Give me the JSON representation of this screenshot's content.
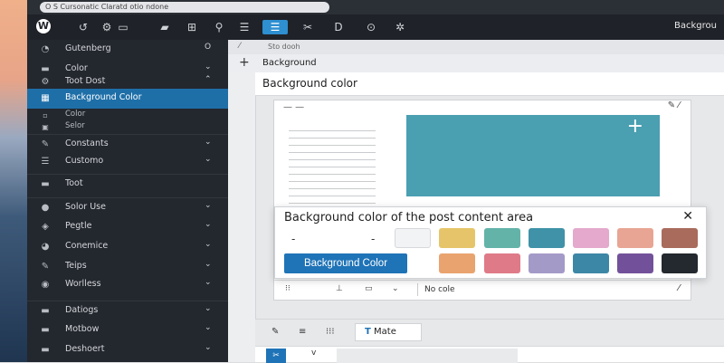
{
  "browser": {
    "url": "O  S Cursonatic Claratd otio ndone"
  },
  "adminbar": {
    "right_label": "Backgrou"
  },
  "sidebar": {
    "items": [
      {
        "label": "Gutenberg",
        "chev": "O"
      },
      {
        "label": "Color",
        "chev": "⌄"
      },
      {
        "label": "Toot Dost",
        "chev": "⌃"
      },
      {
        "label": "Background Color",
        "chev": ""
      },
      {
        "label": "Color",
        "chev": ""
      },
      {
        "label": "Selor",
        "chev": ""
      },
      {
        "label": "Constants",
        "chev": "⌄"
      },
      {
        "label": "Customo",
        "chev": "⌄"
      },
      {
        "label": "Toot",
        "chev": ""
      },
      {
        "label": "Solor Use",
        "chev": "⌄"
      },
      {
        "label": "Pegtle",
        "chev": "⌄"
      },
      {
        "label": "Conemice",
        "chev": "⌄"
      },
      {
        "label": "Teips",
        "chev": "⌄"
      },
      {
        "label": "Worlless",
        "chev": "⌄"
      },
      {
        "label": "Datiogs",
        "chev": "⌄"
      },
      {
        "label": "Motbow",
        "chev": "⌄"
      },
      {
        "label": "Deshoert",
        "chev": "⌄"
      }
    ]
  },
  "main": {
    "breadcrumb": "Sto dooh",
    "panel_title": "Background",
    "title": "Background color",
    "preview": {
      "no_color_label": "No cole"
    },
    "popover": {
      "title": "Background color of the post content area",
      "button_label": "Background Color",
      "swatches": [
        "#f2f3f5",
        "#e6c56a",
        "#63b3a9",
        "#3f92a8",
        "#e4a9cc",
        "#e8a594",
        "#a86b5c",
        "#e9a36e",
        "#df7a88",
        "#a49ac8",
        "#3d87a6",
        "#73519a",
        "#24282f"
      ]
    },
    "toolbar": {
      "mate_label": "Mate"
    }
  },
  "colors": {
    "accent": "#1e6fa8",
    "block": "#4a9fb1",
    "sidebar": "#23272e"
  }
}
